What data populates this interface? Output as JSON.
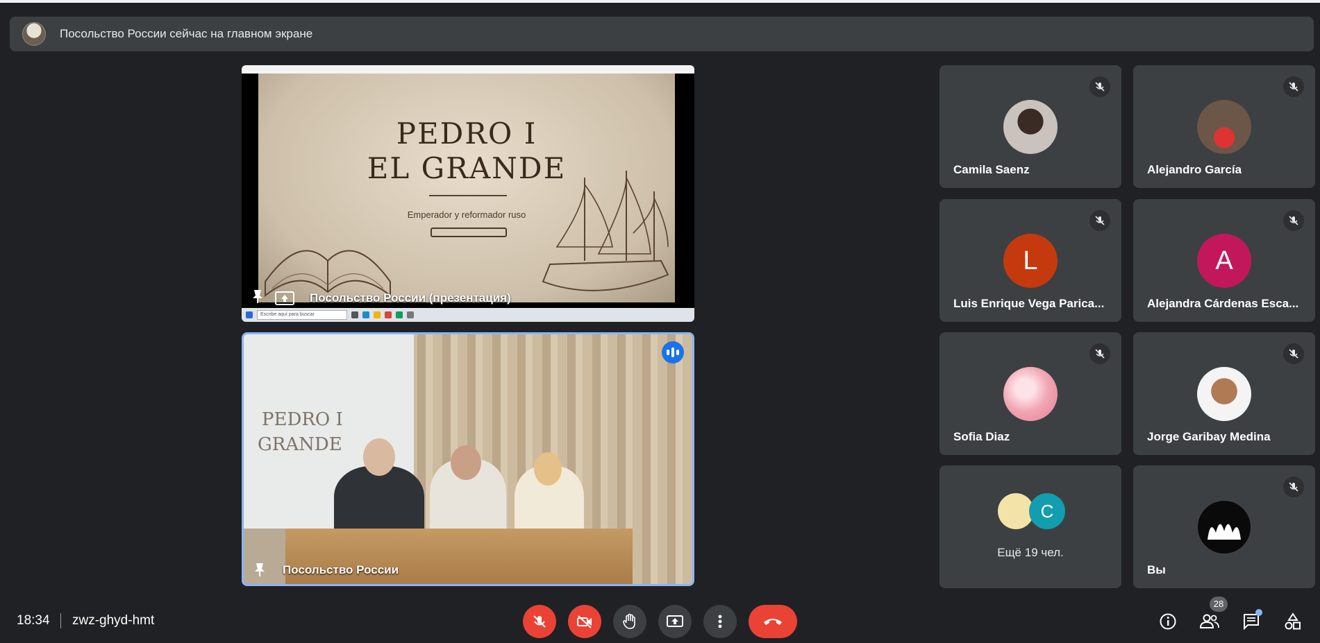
{
  "banner": {
    "text": "Посольство России сейчас на главном экране"
  },
  "presentation": {
    "label": "Посольство России (презентация)",
    "slide_title_1": "PEDRO I",
    "slide_title_2": "EL GRANDE",
    "slide_subtitle": "Emperador y reformador ruso",
    "taskbar_search": "Escribe aquí para buscar"
  },
  "camera": {
    "label": "Посольство России",
    "screen_text_1": "PEDRO I",
    "screen_text_2": "GRANDE"
  },
  "participants": [
    {
      "name": "Camila Saenz",
      "avatar": "photo",
      "color": "#8a7f78"
    },
    {
      "name": "Alejandro García",
      "avatar": "photo",
      "color": "#5a4a40"
    },
    {
      "name": "Luis Enrique Vega Parica...",
      "avatar": "L",
      "color": "#c5390f"
    },
    {
      "name": "Alejandra Cárdenas Esca...",
      "avatar": "A",
      "color": "#c2185b"
    },
    {
      "name": "Sofia Diaz",
      "avatar": "photo",
      "color": "#f4b6c2"
    },
    {
      "name": "Jorge Garibay Medina",
      "avatar": "photo",
      "color": "#e9e9e9"
    },
    {
      "name": "Вы",
      "avatar": "photo",
      "color": "#0a0a0a"
    }
  ],
  "more_people": {
    "text": "Ещё 19 чел.",
    "avatar_letter": "C",
    "avatar_color": "#129eaf"
  },
  "footer": {
    "time": "18:34",
    "meeting_code": "zwz-ghyd-hmt",
    "people_count": "28"
  },
  "icons": {
    "mic_off": "mic-off-icon",
    "camera_off": "videocam-off-icon",
    "raise_hand": "hand-icon",
    "present": "present-screen-icon",
    "more": "more-vert-icon",
    "leave": "call-end-icon",
    "info": "info-icon",
    "people": "people-icon",
    "chat": "chat-icon",
    "activities": "activities-icon"
  },
  "colors": {
    "accent": "#8ab4f8",
    "danger": "#ea4335",
    "tile": "#3c4043",
    "bg": "#202124"
  }
}
